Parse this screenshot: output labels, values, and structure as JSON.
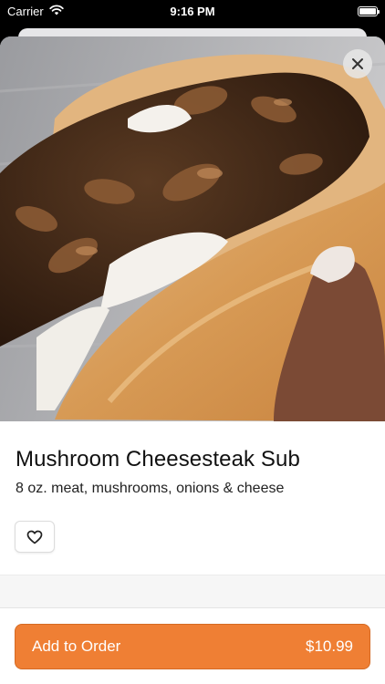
{
  "status_bar": {
    "carrier": "Carrier",
    "time": "9:16 PM"
  },
  "item": {
    "name": "Mushroom Cheesesteak Sub",
    "description": "8 oz. meat, mushrooms, onions & cheese"
  },
  "actions": {
    "close_icon": "close-icon",
    "favorite_icon": "heart-outline-icon",
    "add_to_order_label": "Add to Order",
    "price": "$10.99"
  },
  "colors": {
    "accent": "#ef7f34",
    "accent_border": "#d56a23"
  }
}
